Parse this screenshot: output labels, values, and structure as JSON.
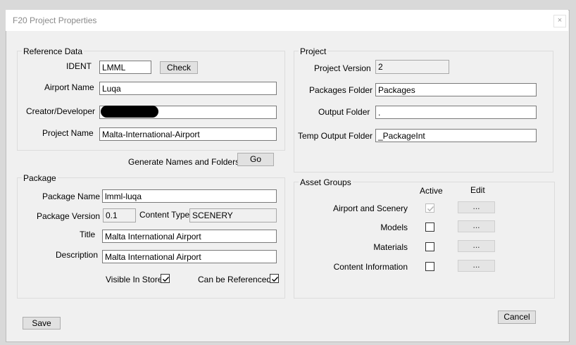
{
  "window": {
    "title": "F20 Project Properties",
    "close_glyph": "×"
  },
  "reference": {
    "legend": "Reference Data",
    "ident_label": "IDENT",
    "ident_value": "LMML",
    "check_label": "Check",
    "airport_name_label": "Airport Name",
    "airport_name_value": "Luqa",
    "creator_label": "Creator/Developer",
    "project_name_label": "Project Name",
    "project_name_value": "Malta-International-Airport"
  },
  "generate": {
    "label": "Generate Names and Folders",
    "go_label": "Go"
  },
  "project": {
    "legend": "Project",
    "version_label": "Project Version",
    "version_value": "2",
    "packages_folder_label": "Packages Folder",
    "packages_folder_value": "Packages",
    "output_folder_label": "Output Folder",
    "output_folder_value": ".",
    "temp_output_label": "Temp Output Folder",
    "temp_output_value": "_PackageInt"
  },
  "package": {
    "legend": "Package",
    "name_label": "Package Name",
    "name_value": "lmml-luqa",
    "version_label": "Package Version",
    "version_value": "0.1",
    "content_type_label": "Content Type",
    "content_type_value": "SCENERY",
    "title_label": "Title",
    "title_value": "Malta International Airport",
    "description_label": "Description",
    "description_value": "Malta International Airport",
    "visible_label": "Visible In Store",
    "visible_checked": true,
    "referenced_label": "Can be Referenced",
    "referenced_checked": true
  },
  "assets": {
    "legend": "Asset Groups",
    "active_header": "Active",
    "edit_header": "Edit",
    "rows": [
      {
        "label": "Airport and Scenery",
        "active": true,
        "disabled": true,
        "edit": "..."
      },
      {
        "label": "Models",
        "active": false,
        "disabled": false,
        "edit": "..."
      },
      {
        "label": "Materials",
        "active": false,
        "disabled": false,
        "edit": "..."
      },
      {
        "label": "Content Information",
        "active": false,
        "disabled": false,
        "edit": "..."
      }
    ]
  },
  "footer": {
    "save_label": "Save",
    "cancel_label": "Cancel"
  }
}
